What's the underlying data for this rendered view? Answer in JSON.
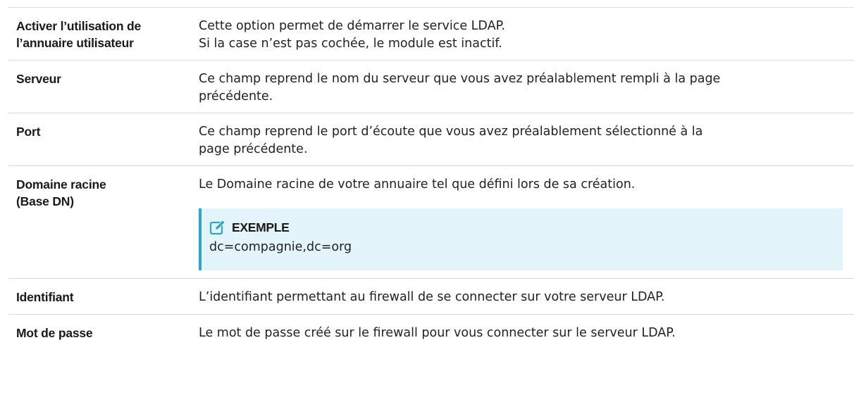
{
  "rows": [
    {
      "term": "Activer l’utilisation de l’annuaire utilisateur",
      "term_lines": [
        "Activer l’utilisation de",
        "l’annuaire utilisateur"
      ],
      "desc_lines": [
        "Cette option permet de démarrer le service LDAP.",
        "Si la case n’est pas cochée, le module est inactif."
      ]
    },
    {
      "term": "Serveur",
      "desc_lines": [
        "Ce champ reprend le nom du serveur que vous avez préalablement rempli à la page",
        "précédente."
      ]
    },
    {
      "term": "Port",
      "desc_lines": [
        "Ce champ reprend le port d’écoute que vous avez préalablement sélectionné à la",
        "page précédente."
      ]
    },
    {
      "term_lines": [
        "Domaine racine",
        "(Base DN)"
      ],
      "desc_lines": [
        "Le Domaine racine de votre annuaire tel que défini lors de sa création."
      ],
      "example": {
        "icon": "edit-icon",
        "title": "EXEMPLE",
        "body": "dc=compagnie,dc=org"
      }
    },
    {
      "term": "Identifiant",
      "desc_lines": [
        "L’identifiant permettant au firewall de se connecter sur votre serveur LDAP."
      ]
    },
    {
      "term": "Mot de passe",
      "desc_lines": [
        "Le mot de passe créé sur le firewall pour vous connecter sur le serveur LDAP."
      ]
    }
  ],
  "colors": {
    "example_bg": "#e3f5fa",
    "example_border": "#2aa6cf",
    "icon": "#2aa6cf",
    "rule": "#d9d9d9"
  }
}
